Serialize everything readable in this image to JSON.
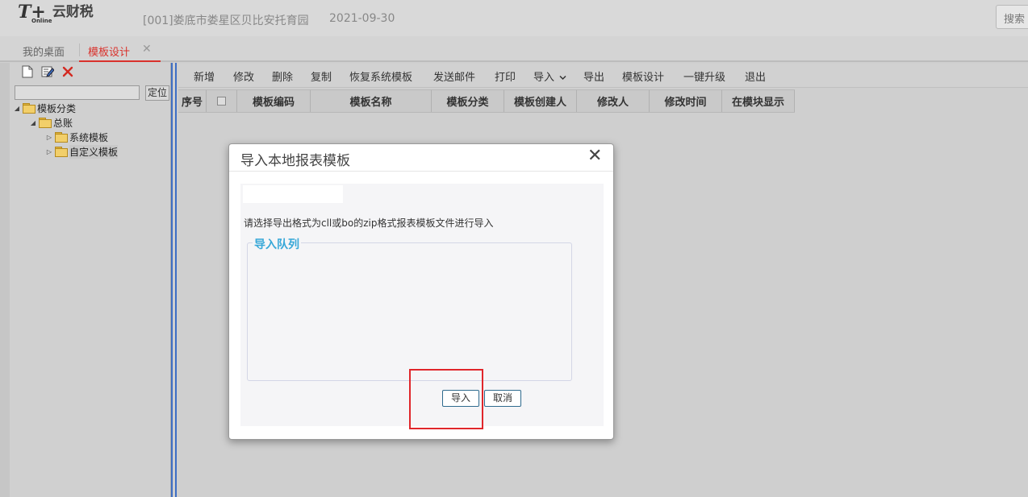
{
  "header": {
    "logo_t": "T+",
    "logo_online": "Online",
    "logo_text": "云财税",
    "org_name": "[001]娄底市娄星区贝比安托育园",
    "date": "2021-09-30",
    "search_label": "搜索"
  },
  "tabs": [
    {
      "label": "我的桌面",
      "active": false
    },
    {
      "label": "模板设计",
      "active": true,
      "close": "✕"
    }
  ],
  "left_panel": {
    "toolbar_icons": [
      "new-file-icon",
      "edit-icon",
      "delete-icon"
    ],
    "locate_value": "",
    "locate_label": "定位",
    "tree": [
      {
        "label": "模板分类",
        "level": 0,
        "expanded": true
      },
      {
        "label": "总账",
        "level": 1,
        "expanded": true
      },
      {
        "label": "系统模板",
        "level": 2,
        "expanded": false
      },
      {
        "label": "自定义模板",
        "level": 2,
        "expanded": false,
        "selected": true
      }
    ]
  },
  "toolbar": {
    "items": [
      "新增",
      "修改",
      "删除",
      "复制",
      "恢复系统模板",
      "发送邮件",
      "打印",
      "导入",
      "导出",
      "模板设计",
      "一键升级",
      "退出"
    ],
    "dropdown_icon": "chevron-down-icon"
  },
  "grid": {
    "columns": [
      "序号",
      "",
      "模板编码",
      "模板名称",
      "模板分类",
      "模板创建人",
      "修改人",
      "修改时间",
      "在模块显示"
    ]
  },
  "dialog": {
    "title": "导入本地报表模板",
    "close": "✕",
    "instruction": "请选择导出格式为cll或bo的zip格式报表模板文件进行导入",
    "queue_legend": "导入队列",
    "import_button": "导入",
    "cancel_button": "取消"
  },
  "colors": {
    "accent_red": "#d9312b",
    "splitter_blue": "#3e6ec4",
    "legend_blue": "#38a8d8",
    "highlight": "#e0262b"
  }
}
